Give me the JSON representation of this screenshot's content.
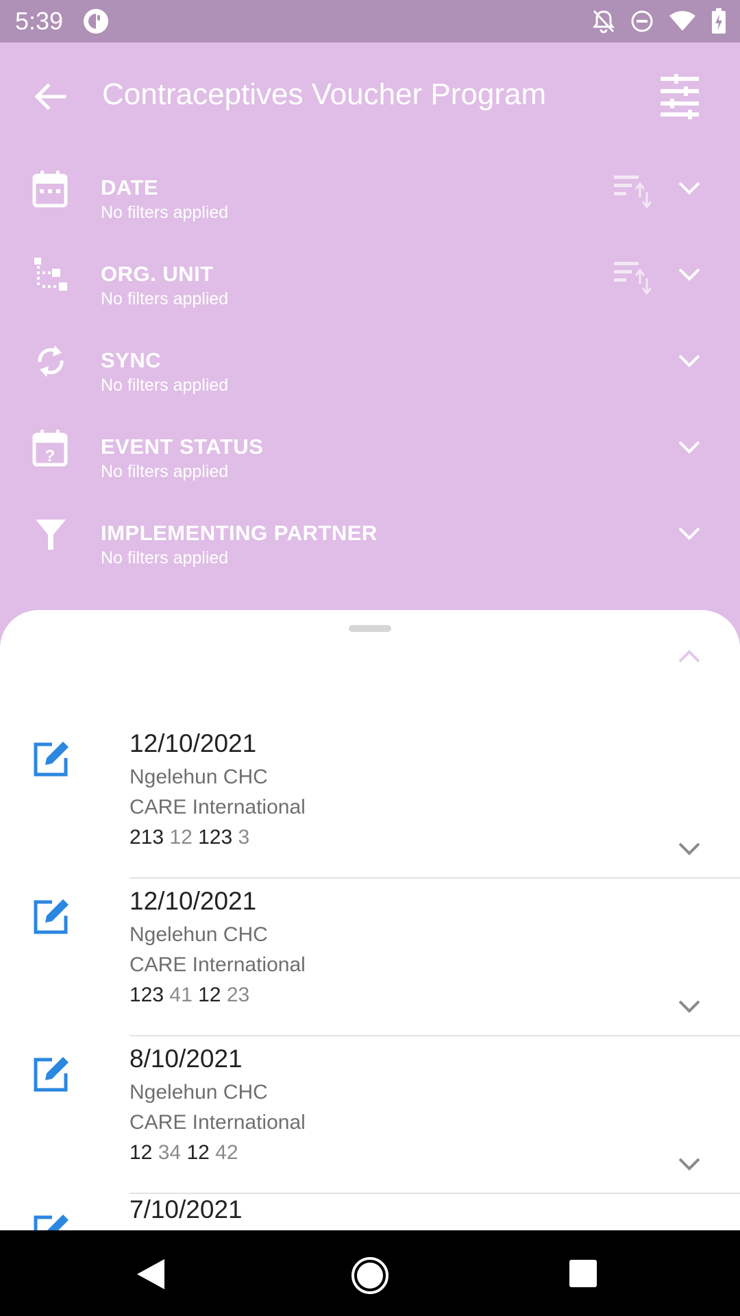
{
  "status_bar": {
    "time": "5:39"
  },
  "toolbar": {
    "title": "Contraceptives Voucher Program"
  },
  "filters": [
    {
      "title": "DATE",
      "subtitle": "No filters applied"
    },
    {
      "title": "ORG. UNIT",
      "subtitle": "No filters applied"
    },
    {
      "title": "SYNC",
      "subtitle": "No filters applied"
    },
    {
      "title": "EVENT STATUS",
      "subtitle": "No filters applied"
    },
    {
      "title": "IMPLEMENTING PARTNER",
      "subtitle": "No filters applied"
    }
  ],
  "events": [
    {
      "date": "12/10/2021",
      "org_unit": "Ngelehun CHC",
      "partner": "CARE International",
      "values": [
        "213",
        "12",
        "123",
        "3"
      ]
    },
    {
      "date": "12/10/2021",
      "org_unit": "Ngelehun CHC",
      "partner": "CARE International",
      "values": [
        "123",
        "41",
        "12",
        "23"
      ]
    },
    {
      "date": "8/10/2021",
      "org_unit": "Ngelehun CHC",
      "partner": "CARE International",
      "values": [
        "12",
        "34",
        "12",
        "42"
      ]
    },
    {
      "date": "7/10/2021"
    }
  ],
  "colors": {
    "header_bg": "#dfbde6",
    "status_bar_bg": "#af90b6",
    "edit_icon": "#2c87e0"
  }
}
